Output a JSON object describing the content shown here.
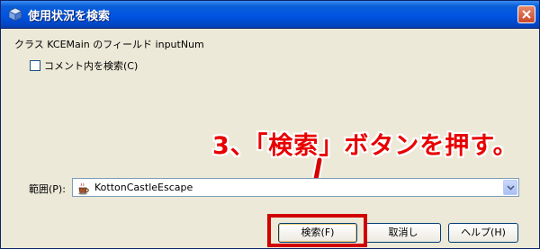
{
  "window": {
    "title": "使用状況を検索",
    "close_icon": "close-icon"
  },
  "header": {
    "description": "クラス KCEMain のフィールド inputNum"
  },
  "options": {
    "comment_checkbox_label": "コメント内を検索(C)",
    "comment_checked": false
  },
  "annotation": {
    "text": "3、「検索」ボタンを押す。",
    "color": "#e80000"
  },
  "scope": {
    "label": "範囲(P):",
    "value": "KottonCastleEscape",
    "icon": "coffee-cup-project-icon"
  },
  "buttons": {
    "search": "検索(F)",
    "cancel": "取消し",
    "help": "ヘルプ(H)"
  },
  "colors": {
    "titlebar": "#0054e3",
    "dialog_bg": "#ece9d8",
    "highlight": "#d10000"
  }
}
